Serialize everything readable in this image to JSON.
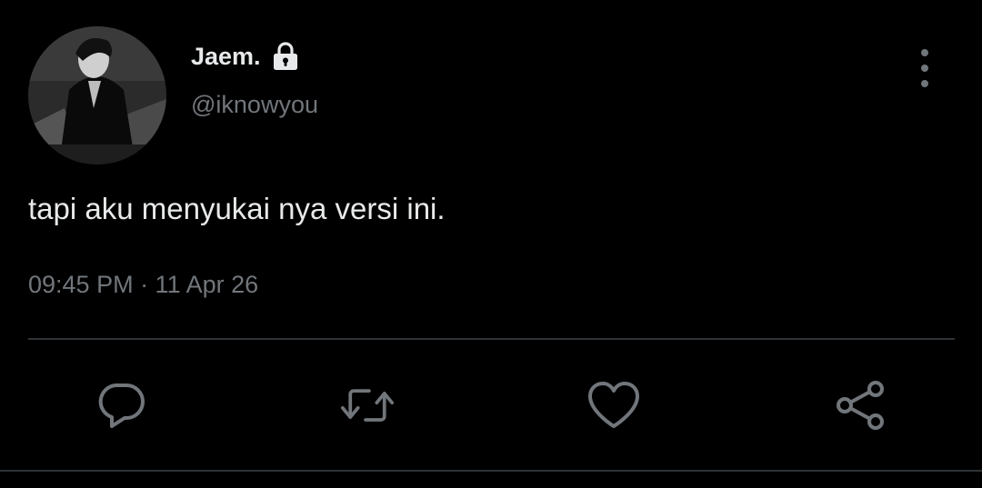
{
  "tweet": {
    "display_name": "Jaem.",
    "handle": "@iknowyou",
    "text": "tapi aku menyukai nya versi ini.",
    "timestamp": "09:45 PM · 11 Apr 26",
    "protected": true
  },
  "icons": {
    "lock": "lock-icon",
    "more": "more-options-icon",
    "reply": "reply-icon",
    "retweet": "retweet-icon",
    "like": "like-icon",
    "share": "share-icon"
  },
  "colors": {
    "background": "#000000",
    "primary_text": "#e7e9ea",
    "secondary_text": "#71767b",
    "divider": "#2f3336"
  }
}
